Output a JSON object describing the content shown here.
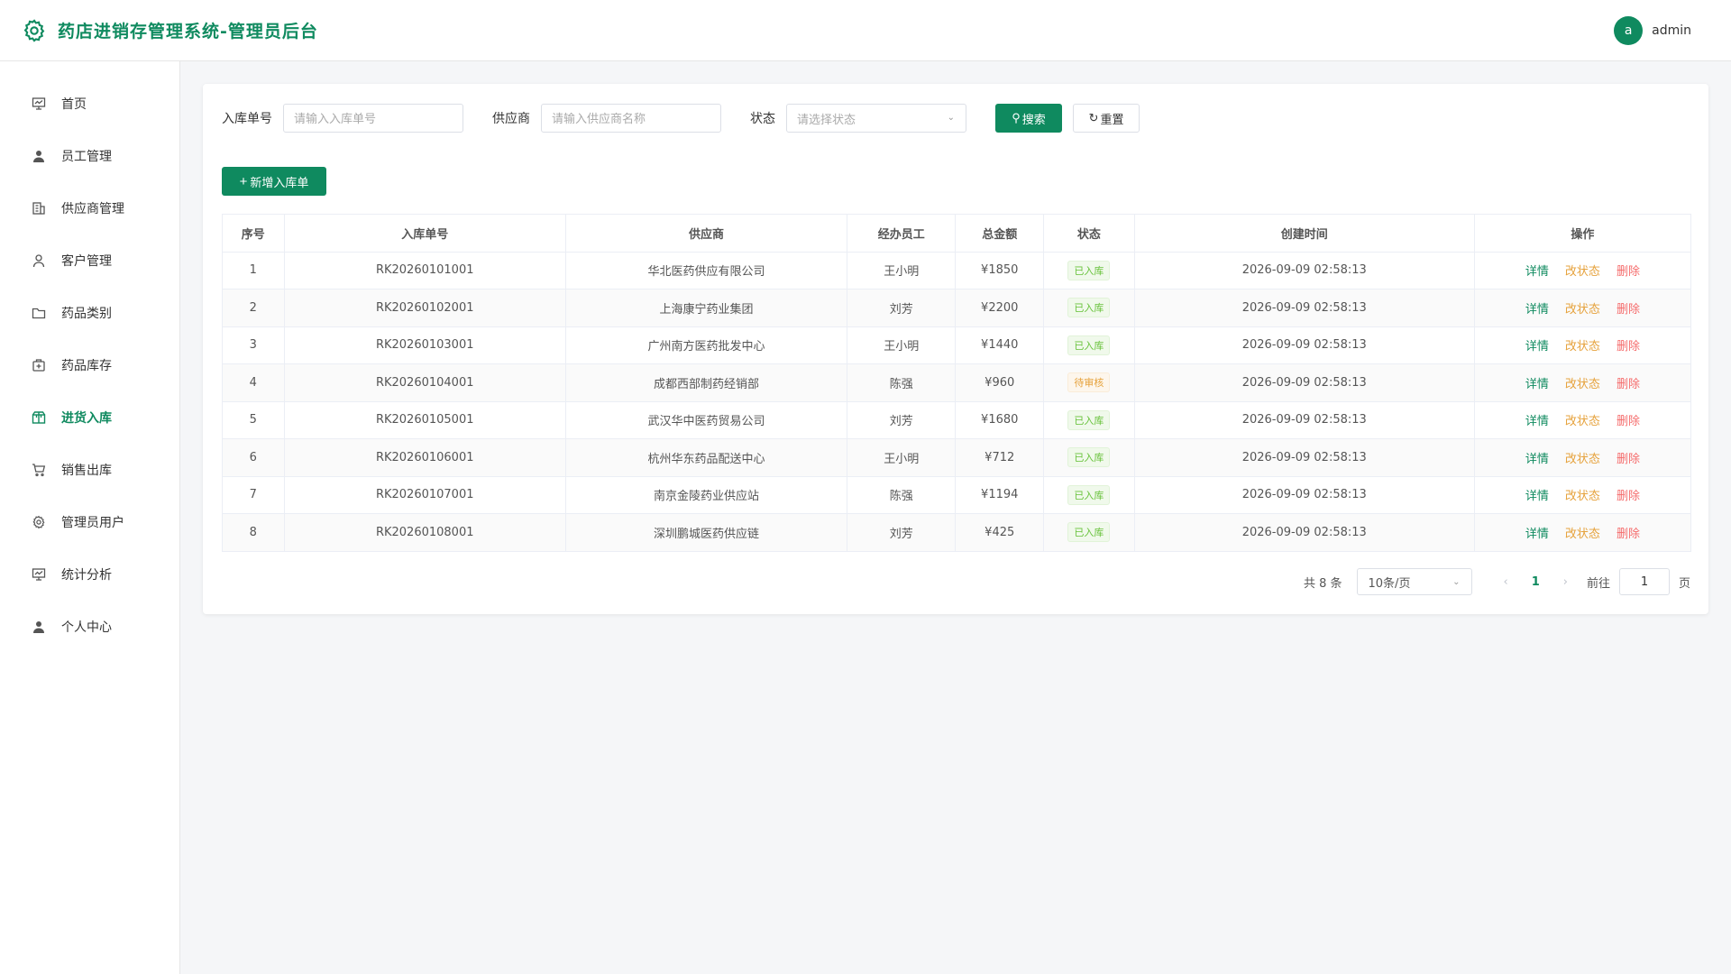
{
  "header": {
    "title": "药店进销存管理系统-管理员后台",
    "avatar_letter": "a",
    "username": "admin"
  },
  "sidebar": {
    "items": [
      {
        "label": "首页",
        "icon": "dashboard-icon",
        "active": false
      },
      {
        "label": "员工管理",
        "icon": "user-icon",
        "active": false
      },
      {
        "label": "供应商管理",
        "icon": "building-icon",
        "active": false
      },
      {
        "label": "客户管理",
        "icon": "user-outline-icon",
        "active": false
      },
      {
        "label": "药品类别",
        "icon": "folder-icon",
        "active": false
      },
      {
        "label": "药品库存",
        "icon": "medicine-box-icon",
        "active": false
      },
      {
        "label": "进货入库",
        "icon": "package-icon",
        "active": true
      },
      {
        "label": "销售出库",
        "icon": "cart-icon",
        "active": false
      },
      {
        "label": "管理员用户",
        "icon": "gear-icon",
        "active": false
      },
      {
        "label": "统计分析",
        "icon": "chart-icon",
        "active": false
      },
      {
        "label": "个人中心",
        "icon": "user-icon",
        "active": false
      }
    ]
  },
  "filters": {
    "order_no_label": "入库单号",
    "order_no_placeholder": "请输入入库单号",
    "supplier_label": "供应商",
    "supplier_placeholder": "请输入供应商名称",
    "status_label": "状态",
    "status_placeholder": "请选择状态",
    "search_label": "搜索",
    "reset_label": "重置"
  },
  "add_button_label": "新增入库单",
  "table": {
    "columns": [
      "序号",
      "入库单号",
      "供应商",
      "经办员工",
      "总金额",
      "状态",
      "创建时间",
      "操作"
    ],
    "rows": [
      {
        "idx": "1",
        "no": "RK20260101001",
        "supplier": "华北医药供应有限公司",
        "staff": "王小明",
        "amount": "¥1850",
        "status": "已入库",
        "status_type": "ok",
        "time": "2026-09-09 02:58:13"
      },
      {
        "idx": "2",
        "no": "RK20260102001",
        "supplier": "上海康宁药业集团",
        "staff": "刘芳",
        "amount": "¥2200",
        "status": "已入库",
        "status_type": "ok",
        "time": "2026-09-09 02:58:13"
      },
      {
        "idx": "3",
        "no": "RK20260103001",
        "supplier": "广州南方医药批发中心",
        "staff": "王小明",
        "amount": "¥1440",
        "status": "已入库",
        "status_type": "ok",
        "time": "2026-09-09 02:58:13"
      },
      {
        "idx": "4",
        "no": "RK20260104001",
        "supplier": "成都西部制药经销部",
        "staff": "陈强",
        "amount": "¥960",
        "status": "待审核",
        "status_type": "wait",
        "time": "2026-09-09 02:58:13"
      },
      {
        "idx": "5",
        "no": "RK20260105001",
        "supplier": "武汉华中医药贸易公司",
        "staff": "刘芳",
        "amount": "¥1680",
        "status": "已入库",
        "status_type": "ok",
        "time": "2026-09-09 02:58:13"
      },
      {
        "idx": "6",
        "no": "RK20260106001",
        "supplier": "杭州华东药品配送中心",
        "staff": "王小明",
        "amount": "¥712",
        "status": "已入库",
        "status_type": "ok",
        "time": "2026-09-09 02:58:13"
      },
      {
        "idx": "7",
        "no": "RK20260107001",
        "supplier": "南京金陵药业供应站",
        "staff": "陈强",
        "amount": "¥1194",
        "status": "已入库",
        "status_type": "ok",
        "time": "2026-09-09 02:58:13"
      },
      {
        "idx": "8",
        "no": "RK20260108001",
        "supplier": "深圳鹏城医药供应链",
        "staff": "刘芳",
        "amount": "¥425",
        "status": "已入库",
        "status_type": "ok",
        "time": "2026-09-09 02:58:13"
      }
    ],
    "actions": {
      "detail": "详情",
      "change": "改状态",
      "delete": "删除"
    }
  },
  "pagination": {
    "total_text": "共 8 条",
    "page_size": "10条/页",
    "current_page": "1",
    "goto_label": "前往",
    "goto_value": "1",
    "page_suffix": "页"
  },
  "colors": {
    "primary": "#0f8a5f",
    "warning": "#e6a23c",
    "danger": "#f56c6c",
    "success": "#67c23a"
  }
}
